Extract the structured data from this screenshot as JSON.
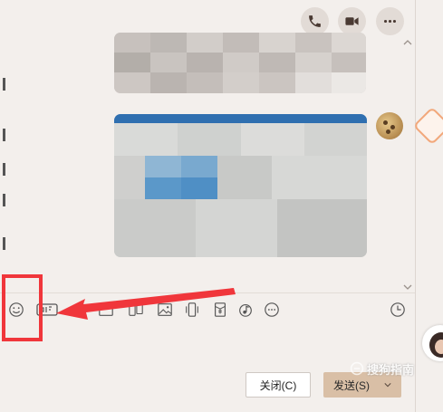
{
  "header": {
    "actions": [
      {
        "name": "voice-call",
        "icon": "phone-icon"
      },
      {
        "name": "video-call",
        "icon": "video-camera-icon"
      },
      {
        "name": "more",
        "icon": "ellipsis-icon"
      }
    ]
  },
  "toolbar": {
    "tools": [
      {
        "name": "emoji",
        "icon": "smiley-icon"
      },
      {
        "name": "gif",
        "icon": "gif-icon"
      },
      {
        "name": "attach",
        "icon": "paperclip-icon"
      },
      {
        "name": "file",
        "icon": "folder-icon"
      },
      {
        "name": "screenshot",
        "icon": "scissors-icon"
      },
      {
        "name": "image",
        "icon": "image-icon"
      },
      {
        "name": "phone",
        "icon": "phone-vibrate-icon"
      },
      {
        "name": "red-packet",
        "icon": "red-packet-icon"
      },
      {
        "name": "music",
        "icon": "music-icon"
      },
      {
        "name": "more",
        "icon": "ellipsis-circle-icon"
      },
      {
        "name": "history",
        "icon": "clock-icon"
      }
    ]
  },
  "buttons": {
    "close_label": "关闭(C)",
    "send_label": "发送(S)"
  },
  "watermark": {
    "text": "搜狗指南"
  },
  "annotation": {
    "color": "#f0363b"
  },
  "colors": {
    "background": "#f3efec",
    "send_button": "#d9bfa6"
  }
}
